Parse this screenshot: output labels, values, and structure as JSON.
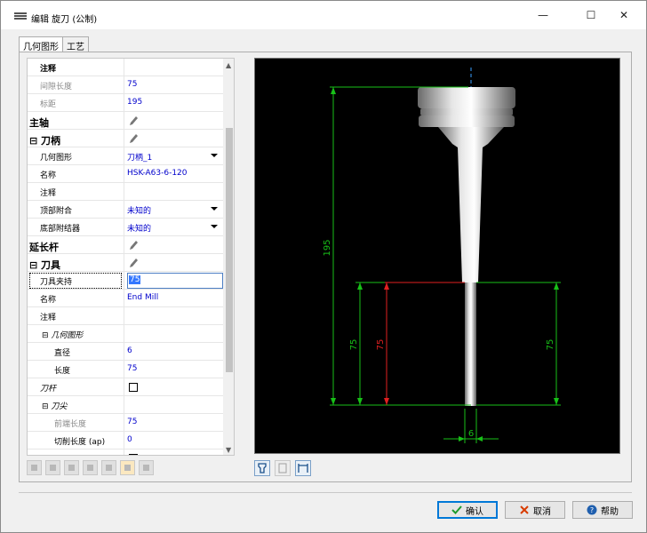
{
  "window": {
    "title": "编辑 旋刀 (公制)",
    "min_glyph": "—",
    "max_glyph": "☐",
    "close_glyph": "✕"
  },
  "tabs": [
    {
      "label": "几何图形",
      "active": true
    },
    {
      "label": "工艺",
      "active": false
    }
  ],
  "props": {
    "r0": {
      "k": "注释",
      "v": ""
    },
    "r1": {
      "k": "间隙长度",
      "v": "75"
    },
    "r2": {
      "k": "标距",
      "v": "195"
    },
    "r3": {
      "k": "主轴"
    },
    "r4": {
      "k": "⊟ 刀柄"
    },
    "r5": {
      "k": "几何图形",
      "v": "刀柄_1"
    },
    "r6": {
      "k": "名称",
      "v": "HSK-A63-6-120"
    },
    "r7": {
      "k": "注释",
      "v": ""
    },
    "r8": {
      "k": "顶部附合",
      "v": "未知的"
    },
    "r9": {
      "k": "底部附结器",
      "v": "未知的"
    },
    "r10": {
      "k": "延长杆"
    },
    "r11": {
      "k": "⊟ 刀具"
    },
    "r12": {
      "k": "刀具夹持",
      "v": "75"
    },
    "r13": {
      "k": "名称",
      "v": "End Mill"
    },
    "r14": {
      "k": "注释",
      "v": ""
    },
    "r15": {
      "k": "⊟ 几何图形"
    },
    "r16": {
      "k": "直径",
      "v": "6"
    },
    "r17": {
      "k": "长度",
      "v": "75"
    },
    "r18": {
      "k": "刀杆"
    },
    "r19": {
      "k": "⊟ 刀尖"
    },
    "r20": {
      "k": "前端长度",
      "v": "75"
    },
    "r21": {
      "k": "切削长度 (ap)",
      "v": "0"
    },
    "r22": {
      "k": "锥尖"
    }
  },
  "drawing": {
    "dim_gauge": "195",
    "dim_left": "75",
    "dim_red": "75",
    "dim_right": "75",
    "dim_diam": "6",
    "colors": {
      "green": "#18c018",
      "red": "#e02020",
      "axis": "#3aa0ff"
    }
  },
  "buttons": {
    "ok": "确认",
    "cancel": "取消",
    "help": "帮助"
  },
  "icons": {
    "ok": "check-icon",
    "cancel": "x-icon",
    "help": "help-icon"
  }
}
